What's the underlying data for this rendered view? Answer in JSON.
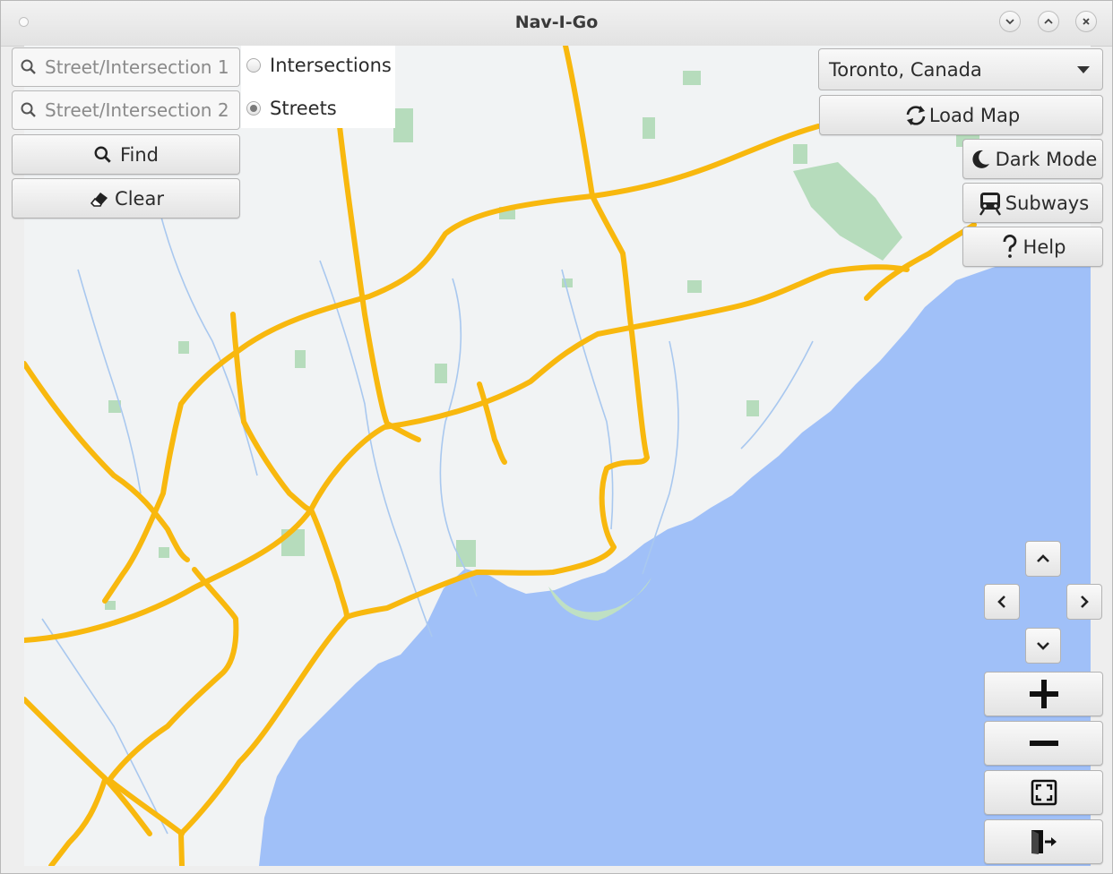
{
  "window": {
    "title": "Nav-I-Go"
  },
  "search": {
    "field1_placeholder": "Street/Intersection 1",
    "field2_placeholder": "Street/Intersection 2",
    "find_label": "Find",
    "clear_label": "Clear"
  },
  "mode": {
    "options": [
      "Intersections",
      "Streets"
    ],
    "selected": "Streets"
  },
  "map_select": {
    "selected": "Toronto, Canada"
  },
  "actions": {
    "load_map": "Load Map",
    "dark_mode": "Dark Mode",
    "subways": "Subways",
    "help": "Help"
  },
  "colors": {
    "land": "#f1f3f4",
    "water": "#a0c0f8",
    "park": "#a8d8b0",
    "highway": "#f8b80e",
    "river": "#a9c8ef"
  },
  "icons": [
    "search-icon",
    "eraser-icon",
    "refresh-icon",
    "moon-icon",
    "train-icon",
    "question-icon",
    "chevron-up-icon",
    "chevron-left-icon",
    "chevron-right-icon",
    "chevron-down-icon",
    "plus-icon",
    "minus-icon",
    "fit-screen-icon",
    "exit-icon"
  ]
}
